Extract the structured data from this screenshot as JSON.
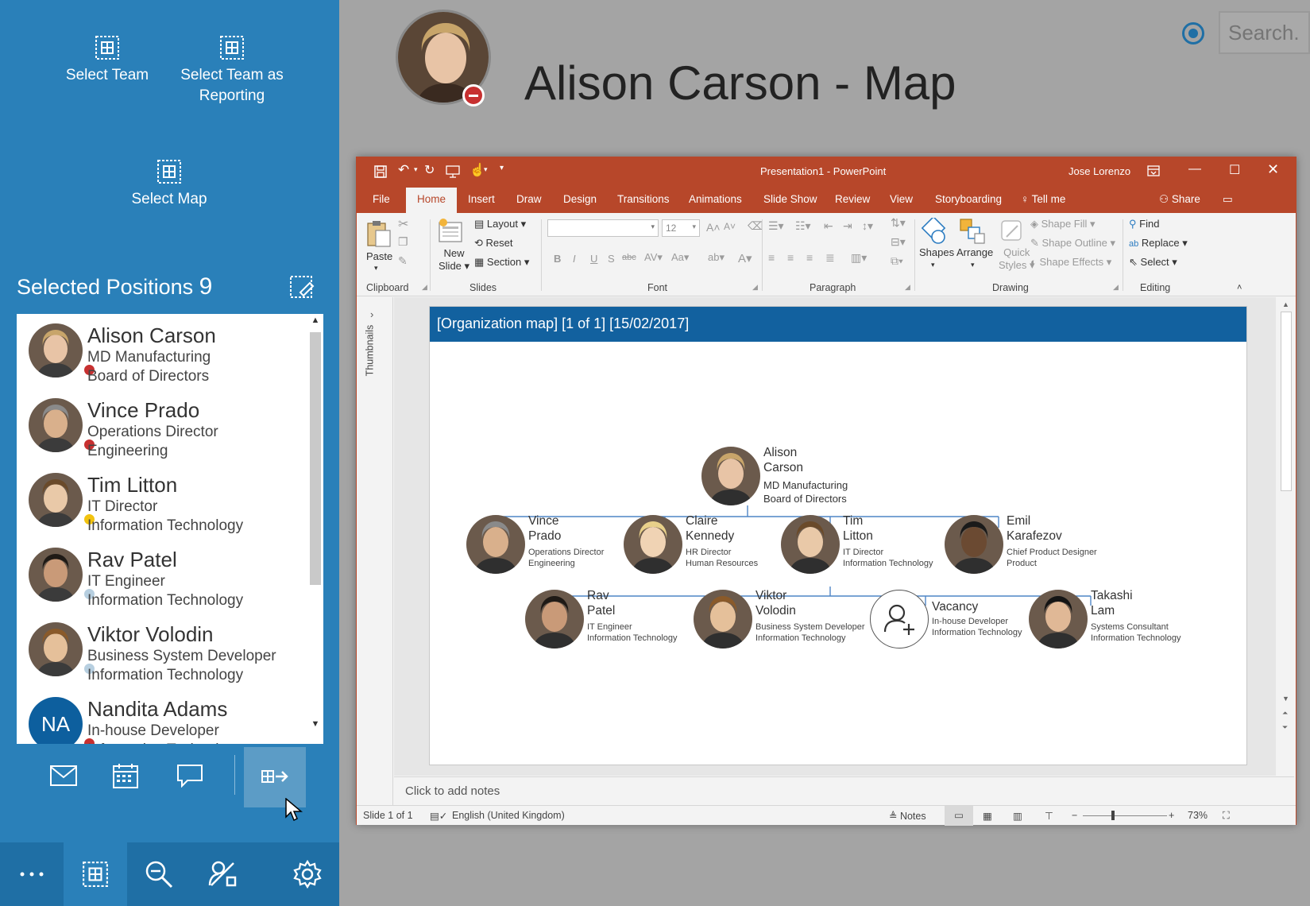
{
  "sidebar": {
    "actions": [
      {
        "label": "Select Team",
        "icon": "grid-icon"
      },
      {
        "label": "Select Team as Reporting",
        "icon": "grid-icon"
      },
      {
        "label": "Select Map",
        "icon": "grid-icon"
      }
    ],
    "selected_title": "Selected Positions",
    "selected_count": "9",
    "positions": [
      {
        "name": "Alison Carson",
        "role": "MD Manufacturing",
        "dept": "Board of Directors",
        "status": "#c73030"
      },
      {
        "name": "Vince Prado",
        "role": "Operations Director",
        "dept": "Engineering",
        "status": "#c73030"
      },
      {
        "name": "Tim Litton",
        "role": "IT Director",
        "dept": "Information Technology",
        "status": "#f2c30f"
      },
      {
        "name": "Rav Patel",
        "role": "IT Engineer",
        "dept": "Information Technology",
        "status": "#b7cfe0"
      },
      {
        "name": "Viktor Volodin",
        "role": "Business System Developer",
        "dept": "Information Technology",
        "status": "#b7cfe0"
      },
      {
        "name": "Nandita Adams",
        "role": "In-house Developer",
        "dept": "Information Technology",
        "status": "#c73030",
        "initials": "NA"
      }
    ],
    "action_icons": [
      "mail-icon",
      "calendar-icon",
      "chat-icon",
      "export-icon"
    ],
    "bottom_icons": [
      "more-icon",
      "grid-icon",
      "zoom-out-icon",
      "position-icon",
      "settings-icon"
    ]
  },
  "header": {
    "title": "Alison Carson  - Map",
    "search_placeholder": "Search...",
    "status_color": "#c73030"
  },
  "ppt": {
    "window_title": "Presentation1  -  PowerPoint",
    "user": "Jose Lorenzo",
    "tabs": [
      "File",
      "Home",
      "Insert",
      "Draw",
      "Design",
      "Transitions",
      "Animations",
      "Slide Show",
      "Review",
      "View",
      "Storyboarding"
    ],
    "tell_me": "Tell me",
    "share": "Share",
    "ribbon": {
      "paste": "Paste",
      "new_slide": "New\nSlide",
      "layout": "Layout",
      "reset": "Reset",
      "section": "Section",
      "font_size": "12",
      "shapes": "Shapes",
      "arrange": "Arrange",
      "quick_styles": "Quick\nStyles",
      "shape_fill": "Shape Fill",
      "shape_outline": "Shape Outline",
      "shape_effects": "Shape Effects",
      "find": "Find",
      "replace": "Replace",
      "select": "Select",
      "groups": [
        "Clipboard",
        "Slides",
        "Font",
        "Paragraph",
        "Drawing",
        "Editing"
      ]
    },
    "thumbnails": "Thumbnails",
    "slide_header": "[Organization map] [1 of 1] [15/02/2017]",
    "notes_placeholder": "Click to add notes",
    "status": {
      "slide": "Slide 1 of 1",
      "language": "English (United Kingdom)",
      "notes": "Notes",
      "zoom": "73%"
    }
  },
  "org": [
    {
      "first": "Alison",
      "last": "Carson",
      "role": "MD Manufacturing",
      "dept": "Board of Directors"
    },
    {
      "first": "Vince",
      "last": "Prado",
      "role": "Operations Director",
      "dept": "Engineering"
    },
    {
      "first": "Claire",
      "last": "Kennedy",
      "role": "HR Director",
      "dept": "Human Resources"
    },
    {
      "first": "Tim",
      "last": "Litton",
      "role": "IT Director",
      "dept": "Information Technology"
    },
    {
      "first": "Emil",
      "last": "Karafezov",
      "role": "Chief Product Designer",
      "dept": "Product"
    },
    {
      "first": "Rav",
      "last": "Patel",
      "role": "IT Engineer",
      "dept": "Information Technology"
    },
    {
      "first": "Viktor",
      "last": "Volodin",
      "role": "Business System Developer",
      "dept": "Information Technology"
    },
    {
      "first": "Vacancy",
      "last": "",
      "role": "In-house Developer",
      "dept": "Information Technology"
    },
    {
      "first": "Takashi",
      "last": "Lam",
      "role": "Systems Consultant",
      "dept": "Information Technology"
    }
  ]
}
